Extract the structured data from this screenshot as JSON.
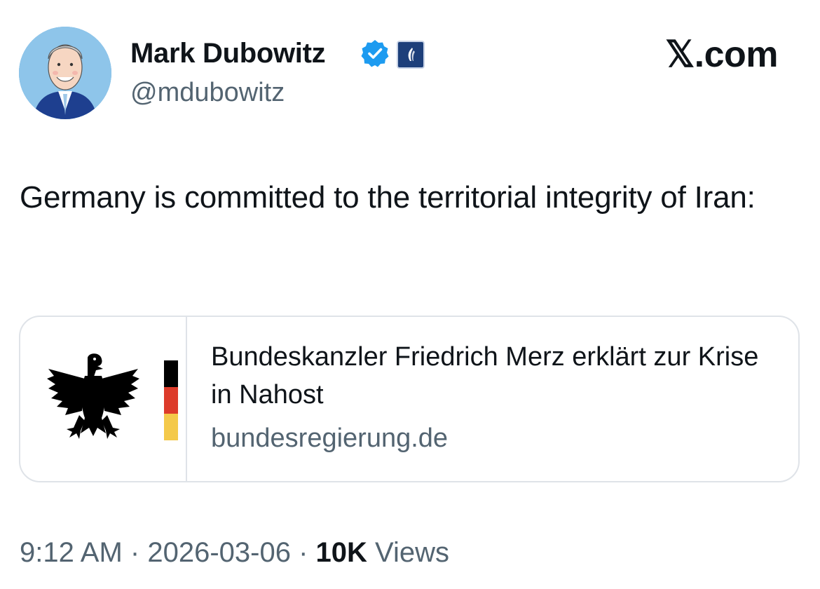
{
  "author": {
    "display_name": "Mark Dubowitz",
    "handle": "@mdubowitz",
    "verified_icon": "verified-badge-icon",
    "affiliation_icon": "affiliation-badge-icon"
  },
  "brand": {
    "label": "𝕏.com"
  },
  "tweet": {
    "text": "Germany is committed to the territorial integrity of Iran:"
  },
  "link_card": {
    "title": "Bundeskanzler Friedrich Merz erklärt zur Krise in Nahost",
    "domain": "bundesregierung.de",
    "logo_icon": "federal-eagle-icon",
    "flag_colors": [
      "#000000",
      "#dd3b2a",
      "#f4c94a"
    ]
  },
  "meta": {
    "time": "9:12 AM",
    "date": "2026-03-06",
    "separator": "·",
    "views_count": "10K",
    "views_label": "Views"
  },
  "colors": {
    "text_primary": "#0f1419",
    "text_secondary": "#536471",
    "verified_blue": "#1d9bf0",
    "border": "#dfe3e8"
  }
}
